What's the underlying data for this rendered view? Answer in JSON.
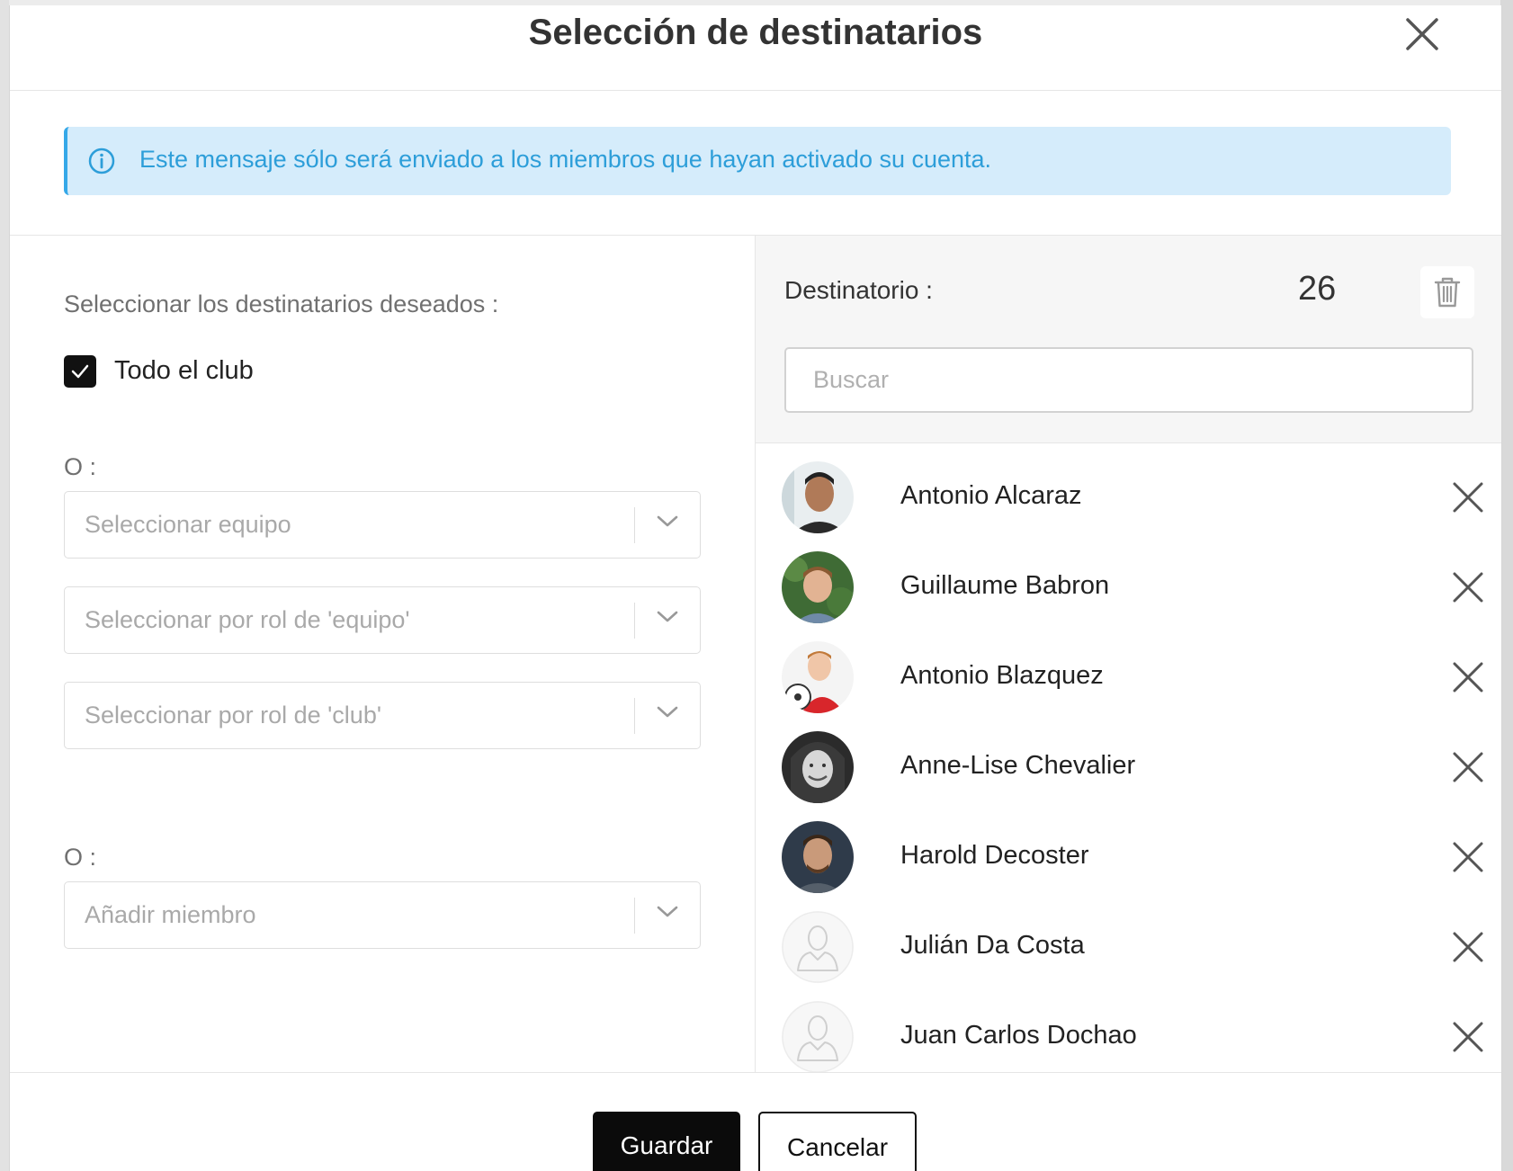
{
  "dialog": {
    "title": "Selección de destinatarios",
    "info": "Este mensaje sólo será enviado a los miembros que hayan activado su cuenta."
  },
  "left": {
    "prompt": "Seleccionar los destinatarios deseados :",
    "whole_club_label": "Todo el club",
    "whole_club_checked": true,
    "or_label_1": "O :",
    "team_select_placeholder": "Seleccionar equipo",
    "team_role_select_placeholder": "Seleccionar por rol de 'equipo'",
    "club_role_select_placeholder": "Seleccionar por rol de 'club'",
    "or_label_2": "O :",
    "member_select_placeholder": "Añadir miembro"
  },
  "right": {
    "recipients_label": "Destinatorio :",
    "recipients_count": "26",
    "search_placeholder": "Buscar",
    "recipients": [
      {
        "name": "Antonio Alcaraz",
        "avatar": "photo"
      },
      {
        "name": "Guillaume Babron",
        "avatar": "photo"
      },
      {
        "name": "Antonio Blazquez",
        "avatar": "photo"
      },
      {
        "name": "Anne-Lise Chevalier",
        "avatar": "photo"
      },
      {
        "name": "Harold Decoster",
        "avatar": "photo"
      },
      {
        "name": "Julián Da Costa",
        "avatar": "placeholder-user-icon"
      },
      {
        "name": "Juan Carlos Dochao",
        "avatar": "placeholder-user-icon"
      }
    ]
  },
  "footer": {
    "save_label": "Guardar",
    "cancel_label": "Cancelar"
  },
  "colors": {
    "info_background": "#d5ecfb",
    "info_text": "#2d9ed9",
    "primary_button": "#0b0b0b"
  }
}
